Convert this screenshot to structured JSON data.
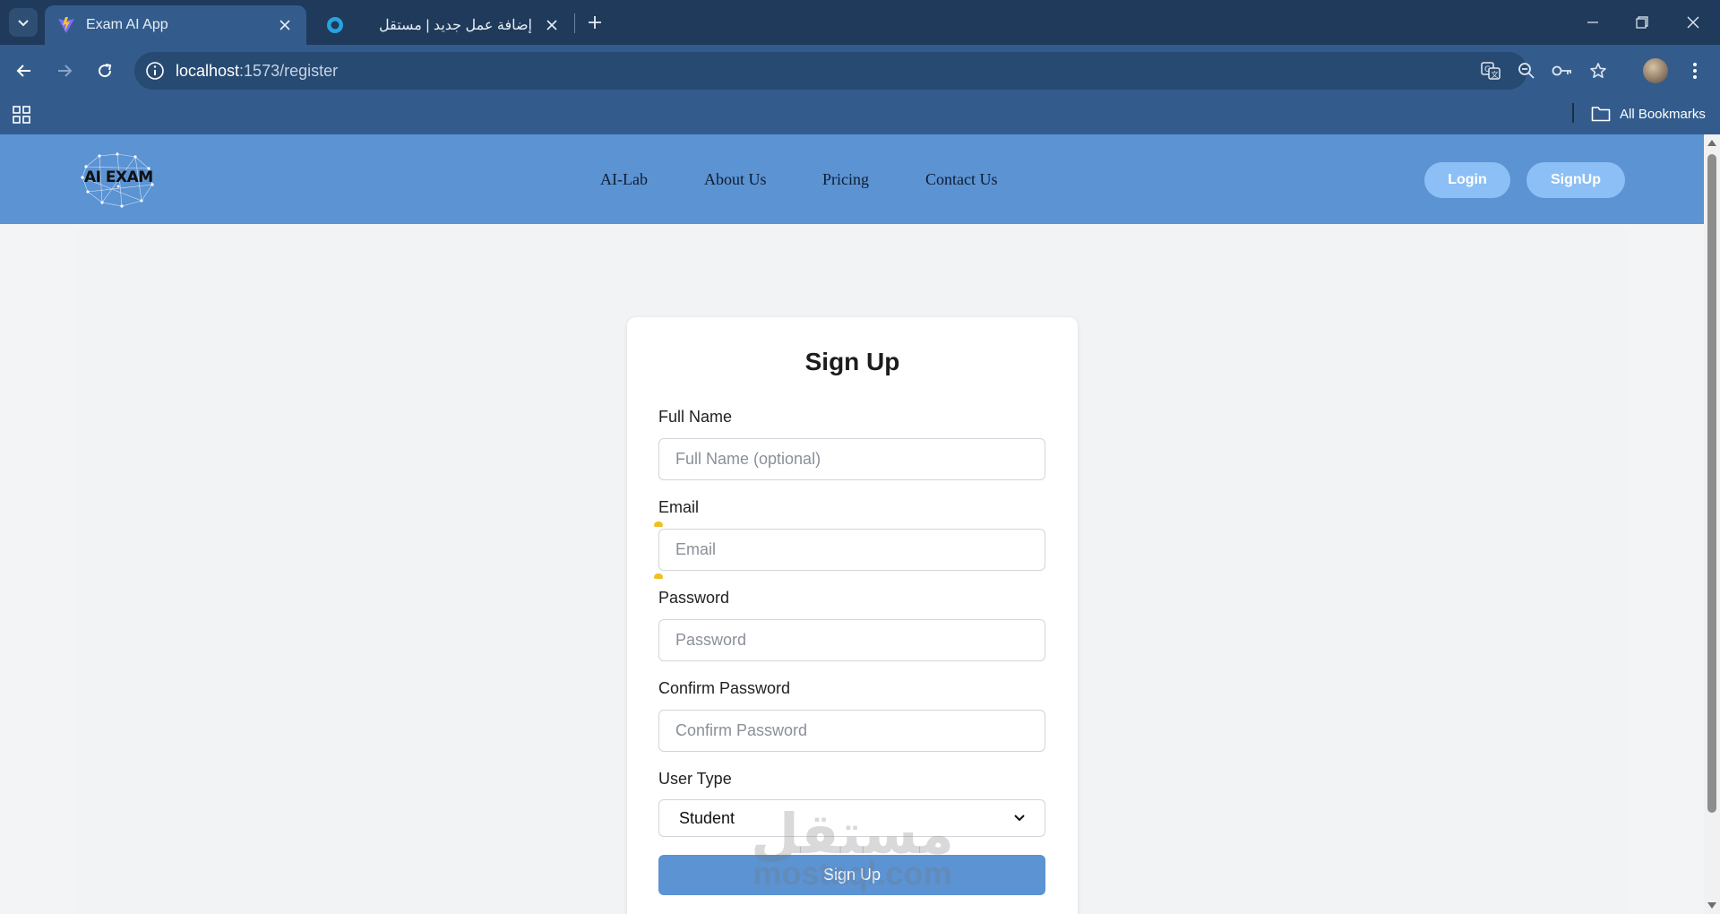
{
  "browser": {
    "tabs": [
      {
        "title": "Exam AI App",
        "active": true
      },
      {
        "title": "إضافة عمل جديد | مستقل",
        "active": false
      }
    ],
    "url_host": "localhost",
    "url_path": ":1573/register",
    "bookmarks_label": "All Bookmarks"
  },
  "site": {
    "logo_text": "AI EXAM",
    "nav": [
      "AI-Lab",
      "About Us",
      "Pricing",
      "Contact Us"
    ],
    "login_label": "Login",
    "signup_label": "SignUp"
  },
  "form": {
    "title": "Sign Up",
    "full_name_label": "Full Name",
    "full_name_placeholder": "Full Name (optional)",
    "email_label": "Email",
    "email_placeholder": "Email",
    "password_label": "Password",
    "password_placeholder": "Password",
    "confirm_label": "Confirm Password",
    "confirm_placeholder": "Confirm Password",
    "user_type_label": "User Type",
    "user_type_value": "Student",
    "submit_label": "Sign Up"
  },
  "watermark": {
    "arabic": "مستقل",
    "latin": "mostaql.com"
  },
  "colors": {
    "chrome_dark": "#1f3a5a",
    "chrome": "#335c8c",
    "header": "#5b93d3",
    "header_button": "#8cbff5",
    "primary": "#5b93d3"
  },
  "icons": [
    "tab-search-icon",
    "vite-icon",
    "circle-favicon-icon",
    "close-icon",
    "plus-icon",
    "minimize-icon",
    "restore-icon",
    "back-icon",
    "forward-icon",
    "reload-icon",
    "info-icon",
    "translate-icon",
    "zoom-out-icon",
    "key-icon",
    "star-icon",
    "avatar",
    "more-vert-icon",
    "apps-icon",
    "folder-icon",
    "chevron-down-icon"
  ]
}
